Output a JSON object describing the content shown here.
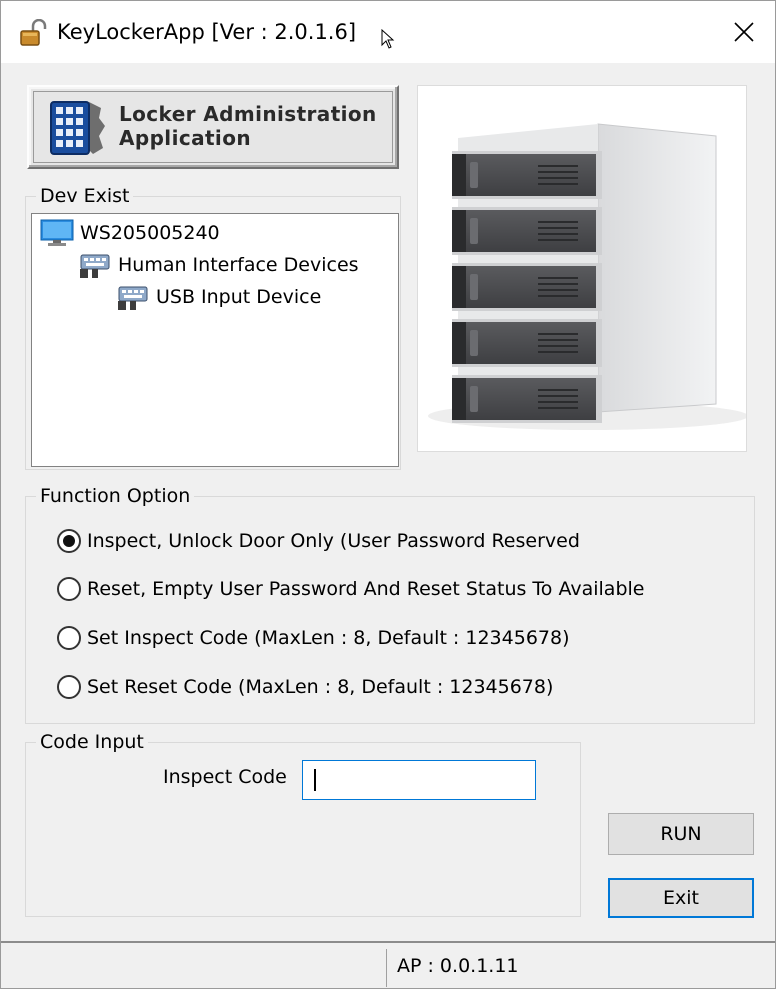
{
  "window": {
    "title": "KeyLockerApp [Ver : 2.0.1.6]"
  },
  "logo": {
    "line1": "Locker Administration",
    "line2": "Application"
  },
  "dev_exist": {
    "label": "Dev Exist",
    "tree": [
      {
        "label": "WS205005240",
        "icon": "computer-icon",
        "level": 0
      },
      {
        "label": "Human Interface Devices",
        "icon": "hid-device-icon",
        "level": 1
      },
      {
        "label": "USB Input Device",
        "icon": "hid-device-icon",
        "level": 2
      }
    ]
  },
  "function_option": {
    "label": "Function Option",
    "options": [
      {
        "label": "Inspect, Unlock Door Only (User Password Reserved",
        "checked": true
      },
      {
        "label": "Reset, Empty User Password And Reset Status To Available",
        "checked": false
      },
      {
        "label": "Set Inspect Code (MaxLen : 8, Default : 12345678)",
        "checked": false
      },
      {
        "label": "Set Reset Code (MaxLen : 8, Default : 12345678)",
        "checked": false
      }
    ]
  },
  "code_input": {
    "label": "Code Input",
    "field_label": "Inspect Code",
    "value": ""
  },
  "buttons": {
    "run": "RUN",
    "exit": "Exit"
  },
  "status": {
    "ap_version": "AP : 0.0.1.11"
  },
  "colors": {
    "focus_accent": "#0078d7",
    "window_bg": "#f0f0f0"
  }
}
